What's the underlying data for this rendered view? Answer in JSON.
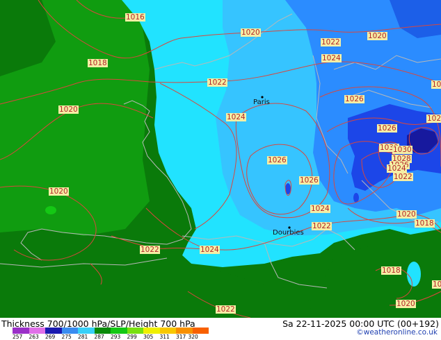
{
  "map": {
    "contour_labels": [
      {
        "id": "iso-1016",
        "text": "1016"
      },
      {
        "id": "iso-1018-w",
        "text": "1018"
      },
      {
        "id": "iso-1020-w",
        "text": "1020"
      },
      {
        "id": "iso-1020-sw",
        "text": "1020"
      },
      {
        "id": "iso-1020-n",
        "text": "1020"
      },
      {
        "id": "iso-1020-ne",
        "text": "1020"
      },
      {
        "id": "iso-1022-n",
        "text": "1022"
      },
      {
        "id": "iso-1024-n",
        "text": "1024"
      },
      {
        "id": "iso-1022-c",
        "text": "1022"
      },
      {
        "id": "iso-1024-c",
        "text": "1024"
      },
      {
        "id": "iso-1026-c",
        "text": "1026"
      },
      {
        "id": "iso-1026-s",
        "text": "1026"
      },
      {
        "id": "iso-1026-e",
        "text": "1026"
      },
      {
        "id": "iso-1026-e2",
        "text": "1026"
      },
      {
        "id": "iso-1030-a",
        "text": "1030"
      },
      {
        "id": "iso-1030-b",
        "text": "1030"
      },
      {
        "id": "iso-1028",
        "text": "1028"
      },
      {
        "id": "iso-1026-e3",
        "text": "1026"
      },
      {
        "id": "iso-1024-e",
        "text": "1024"
      },
      {
        "id": "iso-1022-e",
        "text": "1022"
      },
      {
        "id": "iso-1024-s",
        "text": "1024"
      },
      {
        "id": "iso-1022-s",
        "text": "1022"
      },
      {
        "id": "iso-1022-sw",
        "text": "1022"
      },
      {
        "id": "iso-1024-sw",
        "text": "1024"
      },
      {
        "id": "iso-1020-se",
        "text": "1020"
      },
      {
        "id": "iso-1018-se",
        "text": "1018"
      },
      {
        "id": "iso-1018-se2",
        "text": "1018"
      },
      {
        "id": "iso-1022-bottom",
        "text": "1022"
      },
      {
        "id": "iso-1020-bottom",
        "text": "1020"
      },
      {
        "id": "iso-102-edge1",
        "text": "102"
      },
      {
        "id": "iso-102-edge2",
        "text": "102"
      },
      {
        "id": "iso-10-edge",
        "text": "10"
      }
    ],
    "cities": [
      {
        "id": "city-paris",
        "name": "Paris"
      },
      {
        "id": "city-dourbies",
        "name": "Dourbies"
      }
    ],
    "colors": {
      "thickness_dark_green": "#0a7a0a",
      "thickness_green": "#109c10",
      "thickness_cyan": "#21e3ff",
      "thickness_light_blue": "#36c4ff",
      "thickness_blue": "#2b8cff",
      "thickness_deep_blue": "#1c46e8",
      "thickness_navy": "#17199e",
      "isobar": "#d9473d",
      "border": "#b8b8b8"
    }
  },
  "footer": {
    "title_left": "Thickness 700/1000 hPa/SLP/Height 700 hPa",
    "title_right": "Sa 22-11-2025 00:00 UTC (00+192)",
    "credit": "©weatheronline.co.uk",
    "legend_ticks": [
      "257",
      "263",
      "269",
      "275",
      "281",
      "287",
      "293",
      "299",
      "305",
      "311",
      "317",
      "320"
    ],
    "legend_colors": [
      "#9a30c8",
      "#e070e8",
      "#1a1ab0",
      "#3a8cf0",
      "#38d0f8",
      "#0a8a0a",
      "#14c814",
      "#78e010",
      "#f0f000",
      "#f8c800",
      "#f89000",
      "#f86000"
    ]
  }
}
